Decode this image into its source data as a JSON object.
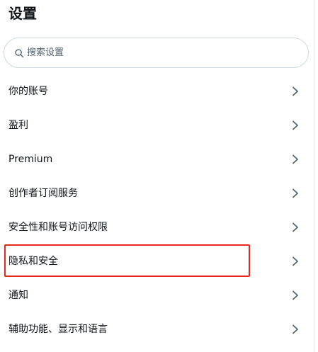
{
  "header": {
    "title": "设置"
  },
  "search": {
    "placeholder": "搜索设置"
  },
  "menu": {
    "items": [
      {
        "id": "account",
        "label": "你的账号"
      },
      {
        "id": "monetization",
        "label": "盈利"
      },
      {
        "id": "premium",
        "label": "Premium"
      },
      {
        "id": "creator-subscriptions",
        "label": "创作者订阅服务"
      },
      {
        "id": "security-access",
        "label": "安全性和账号访问权限"
      },
      {
        "id": "privacy-safety",
        "label": "隐私和安全"
      },
      {
        "id": "notifications",
        "label": "通知"
      },
      {
        "id": "accessibility",
        "label": "辅助功能、显示和语言"
      }
    ]
  },
  "icons": {
    "search": "search-icon",
    "chevron": "chevron-right-icon"
  },
  "colors": {
    "highlight": "#e8271d",
    "border": "#cfd9de",
    "text": "#0f1419",
    "muted": "#536471"
  }
}
